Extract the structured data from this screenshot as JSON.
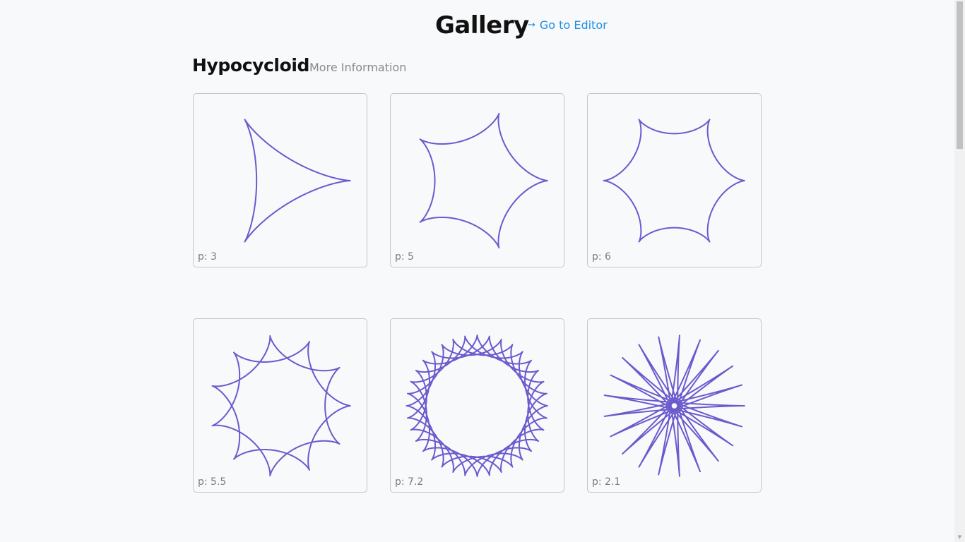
{
  "header": {
    "title": "Gallery",
    "editor_link": {
      "arrow": "→",
      "label": "Go to Editor",
      "arrow_icon": "arrow-right-icon"
    }
  },
  "section": {
    "title": "Hypocycloid",
    "more_info": "More Information"
  },
  "curve_color": "#6a5acd",
  "link_color": "#1d8fe0",
  "cards": [
    {
      "label": "p: 3",
      "p": 3
    },
    {
      "label": "p: 5",
      "p": 5
    },
    {
      "label": "p: 6",
      "p": 6
    },
    {
      "label": "p: 5.5",
      "p": 5.5
    },
    {
      "label": "p: 7.2",
      "p": 7.2
    },
    {
      "label": "p: 2.1",
      "p": 2.1
    }
  ]
}
